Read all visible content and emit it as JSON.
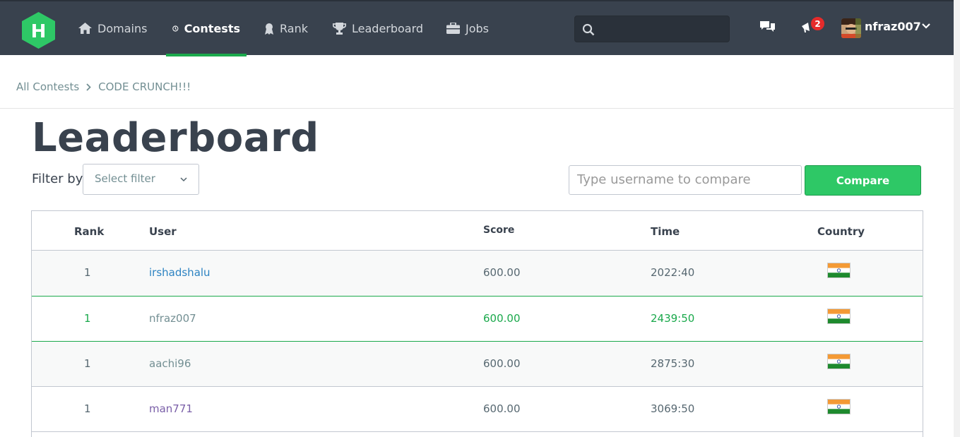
{
  "nav": {
    "items": [
      {
        "label": "Domains",
        "icon": "home-icon"
      },
      {
        "label": "Contests",
        "icon": "clock-icon",
        "active": true
      },
      {
        "label": "Rank",
        "icon": "medal-icon"
      },
      {
        "label": "Leaderboard",
        "icon": "trophy-icon"
      },
      {
        "label": "Jobs",
        "icon": "briefcase-icon"
      }
    ],
    "notification_count": "2",
    "username": "nfraz007",
    "accent": "#1ba94c"
  },
  "breadcrumb": {
    "root": "All Contests",
    "current": "CODE CRUNCH!!!"
  },
  "page": {
    "title": "Leaderboard",
    "filter_label": "Filter by",
    "filter_placeholder": "Select filter",
    "compare_placeholder": "Type username to compare",
    "compare_button": "Compare"
  },
  "table": {
    "headers": {
      "rank": "Rank",
      "user": "User",
      "score": "Score",
      "time": "Time",
      "country": "Country"
    },
    "rows": [
      {
        "rank": "1",
        "user": "irshadshalu",
        "score": "600.00",
        "time": "2022:40",
        "country": "India"
      },
      {
        "rank": "1",
        "user": "nfraz007",
        "score": "600.00",
        "time": "2439:50",
        "country": "India"
      },
      {
        "rank": "1",
        "user": "aachi96",
        "score": "600.00",
        "time": "2875:30",
        "country": "India"
      },
      {
        "rank": "1",
        "user": "man771",
        "score": "600.00",
        "time": "3069:50",
        "country": "India"
      }
    ]
  }
}
